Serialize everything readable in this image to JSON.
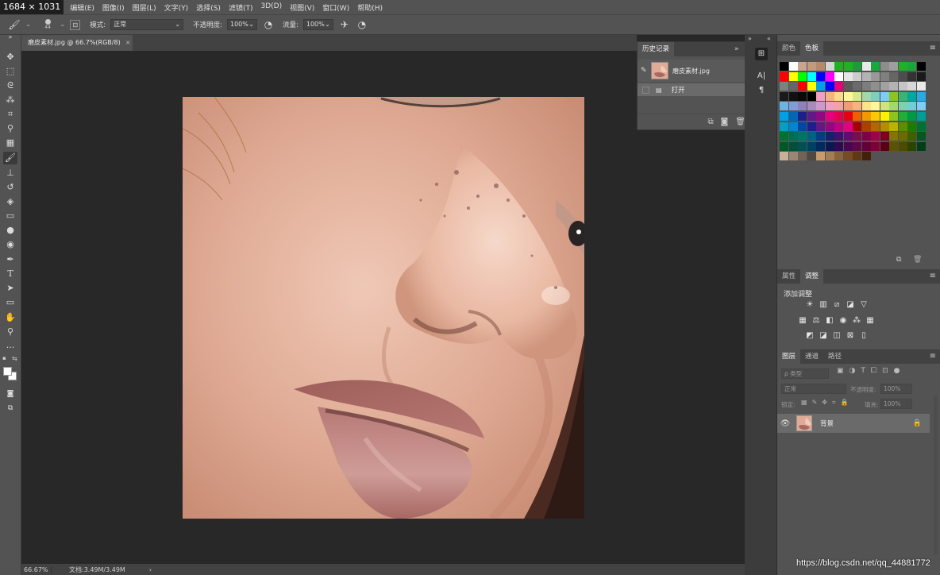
{
  "screen_size_label": "1684 × 1031",
  "menu": [
    "编辑(E)",
    "图像(I)",
    "图层(L)",
    "文字(Y)",
    "选择(S)",
    "滤镜(T)",
    "3D(D)",
    "视图(V)",
    "窗口(W)",
    "帮助(H)"
  ],
  "options_bar": {
    "brush_size": "44",
    "mode_label": "模式:",
    "mode_value": "正常",
    "opacity_label": "不透明度:",
    "opacity_value": "100%",
    "flow_label": "流量:",
    "flow_value": "100%"
  },
  "document": {
    "tab_title": "磨皮素材.jpg @ 66.7%(RGB/8)",
    "close_glyph": "×"
  },
  "status": {
    "zoom": "66.67%",
    "doc_info": "文档:3.49M/3.49M",
    "arrow": "›"
  },
  "history_panel": {
    "tab": "历史记录",
    "snapshot_name": "磨皮素材.jpg",
    "steps": [
      "打开"
    ]
  },
  "color_panel": {
    "tabs": [
      "颜色",
      "色板"
    ],
    "active_tab": 1
  },
  "adjust_panel": {
    "tabs": [
      "属性",
      "调整"
    ],
    "active_tab": 1,
    "title": "添加调整"
  },
  "layers_panel": {
    "tabs": [
      "图层",
      "通道",
      "路径"
    ],
    "active_tab": 0,
    "filter_placeholder": "ρ 类型",
    "blend_mode": "正常",
    "opacity_label": "不透明度:",
    "opacity_value": "100%",
    "lock_label": "锁定:",
    "fill_label": "填充:",
    "fill_value": "100%",
    "layers": [
      {
        "name": "背景",
        "locked": true
      }
    ]
  },
  "watermark": "https://blog.csdn.net/qq_44881772",
  "swatch_colors": [
    [
      "#000000",
      "#ffffff",
      "#c8a58c",
      "#c29b7c",
      "#b6896a",
      "#d6d6d6",
      "#22b022",
      "#22b022",
      "#1e9a3a",
      "#e9e9e9",
      "#19a83d",
      "#8d8d8d",
      "#9e9e9e",
      "#20b02a",
      "#1aa63a",
      "#000000"
    ],
    [
      "#ff0000",
      "#ffff00",
      "#00ff00",
      "#00ffff",
      "#0000ff",
      "#ff00ff",
      "#ffffff",
      "#e6e6e6",
      "#cccccc",
      "#b3b3b3",
      "#999999",
      "#808080",
      "#666666",
      "#4d4d4d",
      "#333333",
      "#1a1a1a"
    ],
    [
      "#808080",
      "#666666",
      "#ff0000",
      "#ffff00",
      "#00a0e9",
      "#0000ff",
      "#e4007f",
      "#595959",
      "#6b6b6b",
      "#7d7d7d",
      "#8f8f8f",
      "#a1a1a1",
      "#b3b3b3",
      "#c5c5c5",
      "#d7d7d7",
      "#e9e9e9"
    ],
    [
      "#1a1a1a",
      "#111111",
      "#0a0a0a",
      "#000000",
      "#f19ec2",
      "#f6b37f",
      "#fadb8c",
      "#fff799",
      "#d5e98d",
      "#a5d6a7",
      "#7fcdbb",
      "#7ecef4",
      "#8fc31f",
      "#3cb371",
      "#00a99d",
      "#29abe2"
    ],
    [
      "#6cb4e4",
      "#7f9ed8",
      "#8f82bc",
      "#aa89bd",
      "#cc99cc",
      "#f09ec2",
      "#f3a2a4",
      "#f29b76",
      "#f6b37f",
      "#fce38a",
      "#fff799",
      "#cde57c",
      "#a4d86e",
      "#7fd1ae",
      "#6fcfd3",
      "#7ecef4"
    ],
    [
      "#00a0e9",
      "#0068b7",
      "#1d2088",
      "#601986",
      "#920783",
      "#e4007f",
      "#e5004f",
      "#e60012",
      "#eb6100",
      "#f39800",
      "#fcc800",
      "#fff100",
      "#8fc31f",
      "#22ac38",
      "#009944",
      "#009e96"
    ],
    [
      "#00a0c1",
      "#0086d1",
      "#00479d",
      "#1d2088",
      "#601986",
      "#920783",
      "#be0081",
      "#e4007f",
      "#a40000",
      "#a84200",
      "#ad6a00",
      "#b48d00",
      "#b8b400",
      "#5c8f00",
      "#1c7c00",
      "#007130"
    ],
    [
      "#007130",
      "#006e54",
      "#00736d",
      "#005e8b",
      "#003e83",
      "#13216a",
      "#3f106e",
      "#620c6f",
      "#7a0c56",
      "#80004a",
      "#a3004a",
      "#7d0022",
      "#807700",
      "#6a6b00",
      "#3e6100",
      "#005826"
    ],
    [
      "#005826",
      "#004e3b",
      "#005152",
      "#004064",
      "#00295f",
      "#0b1653",
      "#2f0a52",
      "#490751",
      "#5e0945",
      "#620039",
      "#7e0035",
      "#5a0018",
      "#5a5400",
      "#4b4c00",
      "#2a4500",
      "#003e1a"
    ],
    [
      "#c7b299",
      "#998675",
      "#736357",
      "#534741",
      "#c69c6d",
      "#a67c52",
      "#8c6239",
      "#754c24",
      "#603913",
      "#42210b"
    ]
  ]
}
